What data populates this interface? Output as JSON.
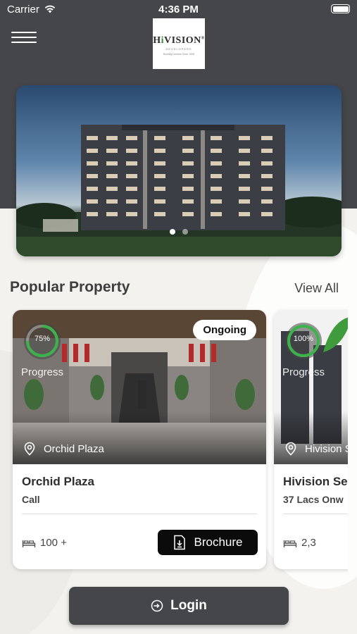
{
  "status_bar": {
    "carrier": "Carrier",
    "time": "4:36 PM"
  },
  "header": {
    "logo": {
      "brand_prefix": "H",
      "brand_leaf": "i",
      "brand_rest": "VISION",
      "mark": "®",
      "sub": "DEVELOPERS",
      "tag": "Building Dreams Since 1998"
    }
  },
  "hero": {
    "slides": 2,
    "active_slide": 1
  },
  "section": {
    "title": "Popular Property",
    "view_all": "View All"
  },
  "cards": [
    {
      "progress_pct": "75%",
      "progress_value": 0.75,
      "progress_label": "Progress",
      "status": "Ongoing",
      "location": "Orchid Plaza",
      "name": "Orchid Plaza",
      "price": "Call",
      "beds": "100 +",
      "brochure": "Brochure"
    },
    {
      "progress_pct": "100%",
      "progress_value": 1.0,
      "progress_label": "Progress",
      "location": "Hivision S",
      "name": "Hivision Se",
      "price": "37 Lacs Onw",
      "beds": "2,3"
    }
  ],
  "login": {
    "label": "Login"
  },
  "colors": {
    "header_bg": "#45464a",
    "progress_ring": "#3bb24a",
    "brochure_bg": "#0b0b0b",
    "login_bg": "#45464a"
  }
}
